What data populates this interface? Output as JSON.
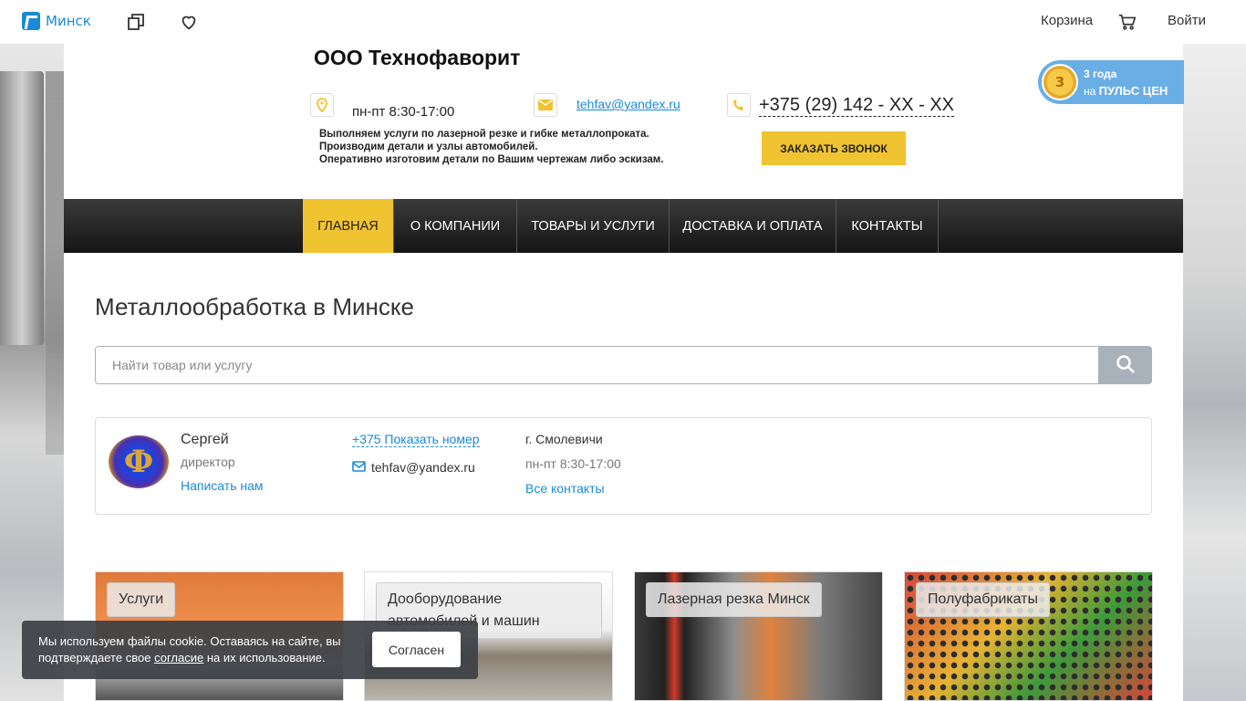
{
  "topbar": {
    "city": "Минск",
    "cart_label": "Корзина",
    "login_label": "Войти"
  },
  "header": {
    "company": "ООО Технофаворит",
    "hours": "пн-пт 8:30-17:00",
    "email": "tehfav@yandex.ru",
    "phone": "+375 (29) 142 - XX - XX",
    "description": [
      "Выполняем услуги по лазерной резке и гибке металлопроката.",
      "Производим детали и узлы автомобилей.",
      "Оперативно изготовим детали по Вашим чертежам либо эскизам."
    ],
    "callback_label": "ЗАКАЗАТЬ ЗВОНОК"
  },
  "badge": {
    "medal_number": "3",
    "line1": "3 года",
    "line2_prefix": "на",
    "line2_brand": "ПУЛЬС ЦЕН"
  },
  "nav": {
    "items": [
      {
        "label": "ГЛАВНАЯ",
        "active": true
      },
      {
        "label": "О КОМПАНИИ",
        "active": false
      },
      {
        "label": "ТОВАРЫ И УСЛУГИ",
        "active": false
      },
      {
        "label": "ДОСТАВКА И ОПЛАТА",
        "active": false
      },
      {
        "label": "КОНТАКТЫ",
        "active": false
      }
    ]
  },
  "main": {
    "title": "Металлообработка в Минске",
    "search_placeholder": "Найти товар или услугу"
  },
  "contact_card": {
    "name": "Сергей",
    "role": "директор",
    "write_us": "Написать нам",
    "show_phone": "+375 Показать номер",
    "email": "tehfav@yandex.ru",
    "city": "г. Смолевичи",
    "hours": "пн-пт 8:30-17:00",
    "all_contacts": "Все контакты"
  },
  "tiles": [
    {
      "label": "Услуги"
    },
    {
      "label": "Дооборудование автомобилей и машин"
    },
    {
      "label": "Лазерная резка Минск"
    },
    {
      "label": "Полуфабрикаты"
    }
  ],
  "cookie": {
    "text_before": "Мы используем файлы cookie. Оставаясь на сайте, вы подтверждаете свое",
    "link": "согласие",
    "text_after": "на их использование.",
    "button": "Согласен"
  },
  "colors": {
    "accent_yellow": "#f0c330",
    "link_blue": "#1a8ad6",
    "nav_dark": "#151515"
  }
}
